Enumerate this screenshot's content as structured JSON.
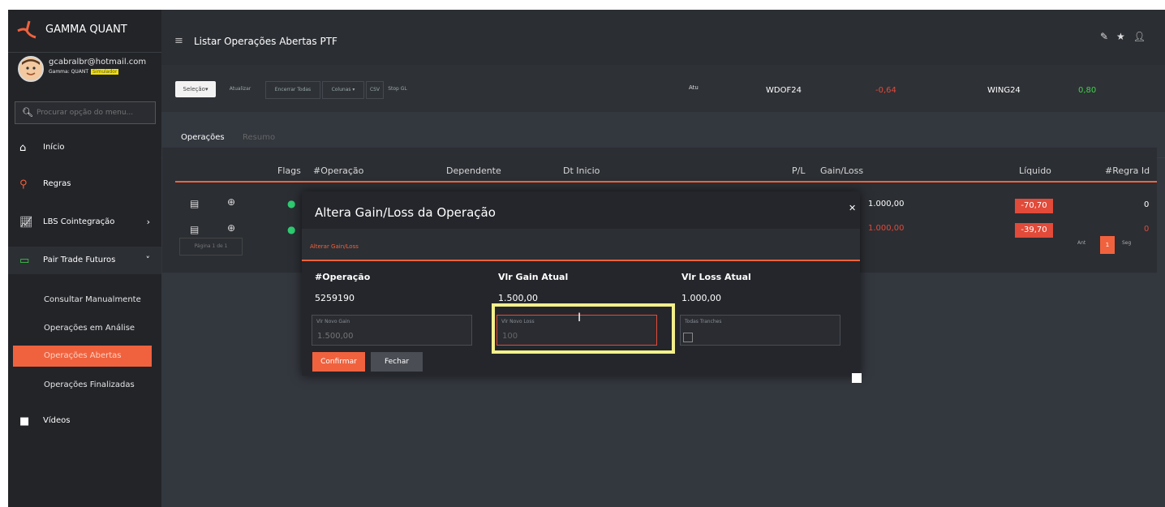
{
  "sidebar": {
    "brand": "GAMMA QUANT",
    "user_email": "gcabralbr@hotmail.com",
    "user_role": "Gamma: QUANT",
    "user_mode": "Simulador",
    "search_placeholder": "Procurar opção do menu...",
    "menu": [
      {
        "label": "Início",
        "icon": "home-icon"
      },
      {
        "label": "Regras",
        "icon": "search-icon"
      },
      {
        "label": "LBS Cointegração",
        "icon": "chart-icon"
      },
      {
        "label": "Pair Trade Futuros",
        "icon": "money-icon"
      },
      {
        "label": "Vídeos",
        "icon": "video-icon"
      }
    ],
    "submenu": [
      {
        "label": "Consultar Manualmente"
      },
      {
        "label": "Operações em Análise"
      },
      {
        "label": "Operações Abertas"
      },
      {
        "label": "Operações Finalizadas"
      }
    ]
  },
  "header": {
    "title": "Listar Operações Abertas PTF"
  },
  "toolbar": {
    "selecao": "Seleção▾",
    "atualizar": "Atualizar",
    "encerrar": "Encerrar Todas",
    "colunas": "Colunas ▾",
    "csv": "CSV",
    "stop": "Stop GL",
    "atu": "Atu",
    "ticker1": "WDOF24",
    "value1": "-0,64",
    "ticker2": "WING24",
    "value2": "0,80"
  },
  "tabs": {
    "operacoes": "Operações",
    "resumo": "Resumo"
  },
  "table": {
    "headers": {
      "flags": "Flags",
      "operacao": "#Operação",
      "dependente": "Dependente",
      "dtinicio": "Dt Inicio",
      "pl": "P/L",
      "gainloss": "Gain/Loss",
      "liquido": "Líquido",
      "regra": "#Regra Id"
    },
    "rows": [
      {
        "gainloss": "1.000,00",
        "liquido": "-70,70",
        "regra": "0"
      },
      {
        "gainloss": "1.000,00",
        "liquido": "-39,70",
        "regra": "0"
      }
    ],
    "pager": "Página 1 de 1",
    "prev": "Ant",
    "page": "1",
    "next": "Seg"
  },
  "modal": {
    "title": "Altera Gain/Loss da Operação",
    "subtitle": "Alterar Gain/Loss",
    "h_operacao": "#Operação",
    "h_gain": "Vlr Gain Atual",
    "h_loss": "Vlr Loss Atual",
    "operacao": "5259190",
    "gain": "1.500,00",
    "loss": "1.000,00",
    "novo_gain_label": "Vlr Novo Gain",
    "novo_gain_placeholder": "1.500,00",
    "novo_loss_label": "Vlr Novo Loss",
    "novo_loss_value": "100",
    "tranches_label": "Todas Tranches",
    "confirm": "Confirmar",
    "close": "Fechar"
  },
  "colors": {
    "accent": "#f0623e",
    "negative": "#e24a39",
    "positive": "#3fd24a"
  }
}
